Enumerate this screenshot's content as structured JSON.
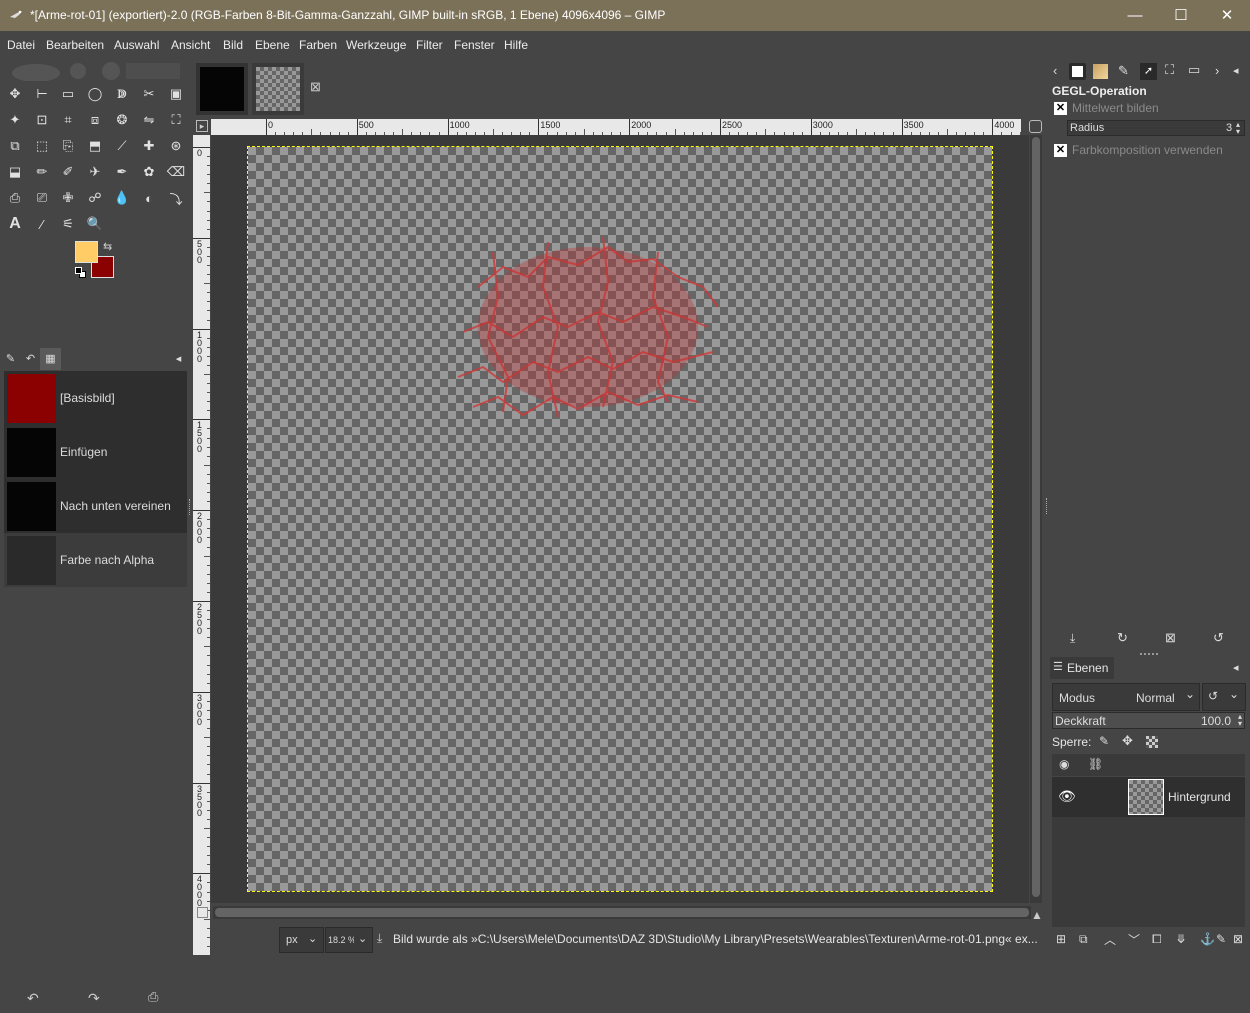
{
  "window": {
    "title": "*[Arme-rot-01] (exportiert)-2.0 (RGB-Farben 8-Bit-Gamma-Ganzzahl, GIMP built-in sRGB, 1 Ebene) 4096x4096 – GIMP",
    "minimize": "—",
    "maximize": "☐",
    "close": "✕"
  },
  "menu": [
    "Datei",
    "Bearbeiten",
    "Auswahl",
    "Ansicht",
    "Bild",
    "Ebene",
    "Farben",
    "Werkzeuge",
    "Filter",
    "Fenster",
    "Hilfe"
  ],
  "colors": {
    "foreground": "#ffcc66",
    "background": "#8b0000",
    "titlebar": "#7b7058"
  },
  "tools": [
    "move-icon",
    "align-icon",
    "rect-select-icon",
    "ellipse-select-icon",
    "free-select-icon",
    "scissors-icon",
    "foreground-select-icon",
    "fuzzy-select-icon",
    "color-select-icon",
    "crop-icon",
    "unified-transform-icon",
    "warp-icon",
    "flip-icon",
    "perspective-icon",
    "cage-icon",
    "handle-transform-icon",
    "seamless-clone-icon",
    "bucket-fill-icon",
    "shear-icon",
    "heal-icon",
    "smudge-icon",
    "gradient-icon",
    "paintbrush-icon",
    "pencil-icon",
    "airbrush-icon",
    "ink-icon",
    "mypaint-icon",
    "eraser-icon",
    "clone-icon",
    "perspective-clone-icon",
    "heal-brush-icon",
    "smudge-brush-icon",
    "blur-icon",
    "dodge-burn-icon",
    "paths-icon",
    "text-icon",
    "color-picker-icon",
    "measure-icon",
    "zoom-icon"
  ],
  "undo_history": {
    "items": [
      {
        "label": "[Basisbild]",
        "thumb": "#8b0000"
      },
      {
        "label": "Einfügen",
        "thumb": "#050505"
      },
      {
        "label": "Nach unten vereinen",
        "thumb": "#050505"
      },
      {
        "label": "Farbe nach Alpha",
        "thumb": "#2a2a2a"
      }
    ],
    "selected_index": 3
  },
  "image_tabs": {
    "close": "⊠"
  },
  "rulers": {
    "h_labels": [
      "0",
      "500",
      "1000",
      "1500",
      "2000",
      "2500",
      "3000",
      "3500",
      "4000"
    ],
    "v_labels": [
      "0",
      "500",
      "1000",
      "1500",
      "2000",
      "2500",
      "3000",
      "3500",
      "4000"
    ]
  },
  "status": {
    "unit": "px",
    "zoom": "18.2 %",
    "message": "Bild wurde als »C:\\Users\\Mele\\Documents\\DAZ 3D\\Studio\\My Library\\Presets\\Wearables\\Texturen\\Arme-rot-01.png« ex..."
  },
  "gegl": {
    "title": "GEGL-Operation",
    "mean_label": "Mittelwert bilden",
    "radius_label": "Radius",
    "radius_value": "3",
    "compose_label": "Farbkomposition verwenden"
  },
  "layers": {
    "tab_label": "Ebenen",
    "mode_label": "Modus",
    "mode_value": "Normal",
    "opacity_label": "Deckkraft",
    "opacity_value": "100.0",
    "lock_label": "Sperre:",
    "layer_name": "Hintergrund"
  }
}
